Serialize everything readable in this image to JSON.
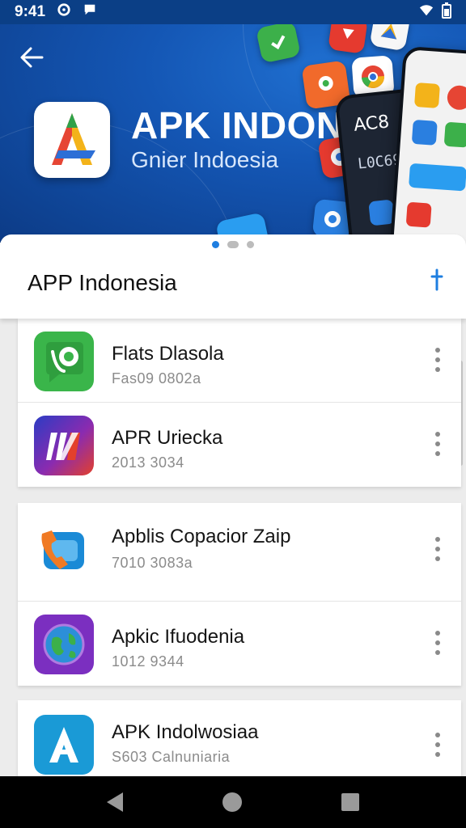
{
  "status_bar": {
    "time": "9:41",
    "left_icons": [
      "gear-icon",
      "chat-icon"
    ],
    "right_icons": [
      "wifi-icon",
      "battery-icon"
    ]
  },
  "hero": {
    "title": "APK INDON",
    "subtitle": "Gnier Indoesia",
    "phone_text_1": "AC8",
    "phone_text_2": "L0C69"
  },
  "carousel": {
    "pages": 3,
    "active_index": 0
  },
  "header": {
    "title": "APP Indonesia",
    "action_icon": "pin-icon"
  },
  "cards": [
    {
      "items": [
        {
          "name": "Flats Dlasola",
          "meta": "Fas09 0802a",
          "icon": "phone-chat-icon",
          "color": "#3ab54a"
        },
        {
          "name": "APR Uriecka",
          "meta": "2013 3034",
          "icon": "stripes-icon",
          "color": "#5a2aa8"
        }
      ]
    },
    {
      "items": [
        {
          "name": "Apblis Copacior Zaip",
          "meta": "7010 3083a",
          "icon": "phone-call-icon",
          "color": "#1a8ad6"
        },
        {
          "name": "Apkic Ifuodenia",
          "meta": "1012 9344",
          "icon": "globe-icon",
          "color": "#7b2fc0"
        }
      ]
    },
    {
      "items": [
        {
          "name": "APK Indolwosiaa",
          "meta": "S603 Calnuniaria",
          "icon": "letter-a-icon",
          "color": "#1a9ad6"
        }
      ]
    }
  ],
  "nav": {
    "buttons": [
      "back-icon",
      "home-icon",
      "recents-icon"
    ]
  }
}
